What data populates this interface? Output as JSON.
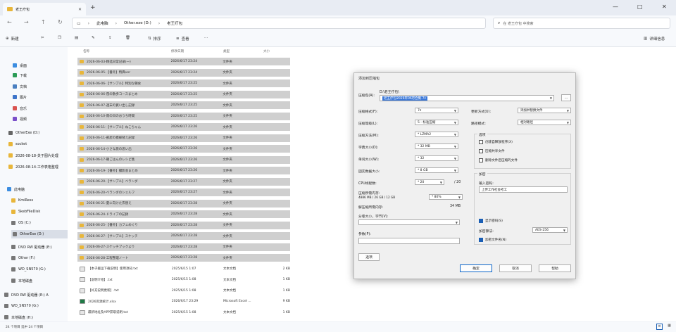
{
  "window": {
    "tab_title": "老王疗包",
    "controls": [
      "—",
      "□",
      "✕"
    ]
  },
  "address": {
    "crumbs": [
      "此电脑",
      "Other.exe (D:)",
      "老王疗包"
    ],
    "search_placeholder": "在 老王疗包 中搜索"
  },
  "toolbar": {
    "new_label": "新建",
    "sort_label": "排序",
    "view_label": "查看",
    "details_label": "详细信息"
  },
  "sidebar": {
    "items": [
      {
        "label": "桌面",
        "color": "#3c8de0"
      },
      {
        "label": "下载",
        "color": "#2a9b56"
      },
      {
        "label": "文档",
        "color": "#4a7fc0"
      },
      {
        "label": "图片",
        "color": "#3d74c9"
      },
      {
        "label": "音乐",
        "color": "#d9534f"
      },
      {
        "label": "视频",
        "color": "#7a4fc9"
      },
      {
        "label": "OtherExe (D:)",
        "color": "#666666"
      },
      {
        "label": "socket",
        "color": "#e8b63a"
      },
      {
        "label": "2026-08-18-关于图片处理",
        "color": "#e8b63a"
      },
      {
        "label": "2026-08-14-工作表格整理",
        "color": "#e8b63a"
      },
      {
        "label": "此电脑",
        "color": "#3c8de0"
      },
      {
        "label": "KmiRess",
        "color": "#e8b63a"
      },
      {
        "label": "SkebFileDisk",
        "color": "#e8b63a"
      },
      {
        "label": "OS (C:)",
        "color": "#777777"
      },
      {
        "label": "OtherExe (D:)",
        "color": "#777777"
      },
      {
        "label": "DVD RW 驱动器 (E:)",
        "color": "#777777"
      },
      {
        "label": "Other (F:)",
        "color": "#777777"
      },
      {
        "label": "WD_SN570 (G:)",
        "color": "#777777"
      },
      {
        "label": "本地磁盘",
        "color": "#777777"
      },
      {
        "label": "DVD RW 驱动器 (E:) A",
        "color": "#777777"
      },
      {
        "label": "WD_SN570 (G:)",
        "color": "#777777"
      },
      {
        "label": "本地磁盘 (H:)",
        "color": "#777777"
      }
    ]
  },
  "filelist": {
    "columns": [
      "名称",
      "修改日期",
      "类型",
      "大小"
    ],
    "rows": [
      {
        "name": "2026-06-03-精选日常记录(一)",
        "date": "2026/6/17 23:24",
        "type": "文件夹",
        "size": "",
        "folder": true
      },
      {
        "name": "2026-06-05-【番外】特典ver",
        "date": "2026/6/17 23:24",
        "type": "文件夹",
        "size": "",
        "folder": true
      },
      {
        "name": "2026-06-06-【サンプル】特別な朝食",
        "date": "2026/6/17 23:25",
        "type": "文件夹",
        "size": "",
        "folder": true
      },
      {
        "name": "2026-06-06-夜の散歩コースまとめ",
        "date": "2026/6/17 23:25",
        "type": "文件夹",
        "size": "",
        "folder": true
      },
      {
        "name": "2026-06-07-週末の買い出し記録",
        "date": "2026/6/17 23:25",
        "type": "文件夹",
        "size": "",
        "folder": true
      },
      {
        "name": "2026-06-10-雨の日のおうち時間",
        "date": "2026/6/17 23:25",
        "type": "文件夹",
        "size": "",
        "folder": true
      },
      {
        "name": "2026-06-11-【サンプル】ねこちゃん",
        "date": "2026/6/17 23:26",
        "type": "文件夹",
        "size": "",
        "folder": true
      },
      {
        "name": "2026-06-11-部屋の模様替え記録",
        "date": "2026/6/17 23:26",
        "type": "文件夹",
        "size": "",
        "folder": true
      },
      {
        "name": "2026-06-14-小さな旅の思い出",
        "date": "2026/6/17 23:26",
        "type": "文件夹",
        "size": "",
        "folder": true
      },
      {
        "name": "2026-06-17-朝ごはんのレシピ集",
        "date": "2026/6/17 23:26",
        "type": "文件夹",
        "size": "",
        "folder": true
      },
      {
        "name": "2026-06-19-【番外】撮影会まとめ",
        "date": "2026/6/17 23:26",
        "type": "文件夹",
        "size": "",
        "folder": true
      },
      {
        "name": "2026-06-20-【サンプル】ベランダ",
        "date": "2026/6/17 23:27",
        "type": "文件夹",
        "size": "",
        "folder": true
      },
      {
        "name": "2026-06-20-ベランダのシェルフ",
        "date": "2026/6/17 23:27",
        "type": "文件夹",
        "size": "",
        "folder": true
      },
      {
        "name": "2026-06-21-夏に向けた衣替え",
        "date": "2026/6/17 23:28",
        "type": "文件夹",
        "size": "",
        "folder": true
      },
      {
        "name": "2026-06-24-ドライブの記録",
        "date": "2026/6/17 23:28",
        "type": "文件夹",
        "size": "",
        "folder": true
      },
      {
        "name": "2026-06-25-【番外】カフェめぐり",
        "date": "2026/6/17 23:28",
        "type": "文件夹",
        "size": "",
        "folder": true
      },
      {
        "name": "2026-06-27-【サンプル】スケッチ",
        "date": "2026/6/17 23:28",
        "type": "文件夹",
        "size": "",
        "folder": true
      },
      {
        "name": "2026-06-27-スケッチブックより",
        "date": "2026/6/17 23:28",
        "type": "文件夹",
        "size": "",
        "folder": true
      },
      {
        "name": "2026-06-28-工程整理ノート",
        "date": "2026/6/17 23:28",
        "type": "文件夹",
        "size": "",
        "folder": true
      },
      {
        "name": "【本子搬运下载说明】使用须知.txt",
        "date": "2025/6/15 1:07",
        "type": "文本文档",
        "size": "2 KB",
        "folder": false
      },
      {
        "name": "【说明介绍】.txt",
        "date": "2025/6/15 1:08",
        "type": "文本文档",
        "size": "1 KB",
        "folder": false
      },
      {
        "name": "【补充说明更新】.txt",
        "date": "2025/6/15 1:08",
        "type": "文本文档",
        "size": "1 KB",
        "folder": false
      },
      {
        "name": "2026资源统计.xlsx",
        "date": "2026/6/17 23:29",
        "type": "Microsoft Excel ...",
        "size": "9 KB",
        "folder": false
      },
      {
        "name": "最新地址及APP获取说明.txt",
        "date": "2025/6/15 1:08",
        "type": "文本文档",
        "size": "1 KB",
        "folder": false
      }
    ]
  },
  "status": {
    "text": "24 个项目   选中 24 个项目"
  },
  "dialog": {
    "title": "添加到压缩包",
    "archive_label": "压缩包(A):",
    "archive_path_label": "D:\\老王疗包\\",
    "archive_value": "老王疗包2026年06月合集.7z",
    "browse_label": "...",
    "format_label": "压缩格式(F):",
    "format_value": "7z",
    "level_label": "压缩等级(L):",
    "level_value": "5 - 标准压缩",
    "method_label": "压缩方法(M):",
    "method_value": "* LZMA2",
    "dict_label": "字典大小(D):",
    "dict_value": "* 32 MB",
    "word_label": "单词大小(W):",
    "word_value": "* 32",
    "solid_label": "固实数据大小:",
    "solid_value": "* 8 GB",
    "cpu_label": "CPU线程数:",
    "cpu_value": "* 20",
    "cpu_max": "/ 20",
    "mem_label": "压缩所需内存:",
    "mem_sub": "4886 MB / 26 GB / 12 GB",
    "mem_value": "* 80%",
    "mem_pct": "",
    "decomp_label": "解压缩所需内存:",
    "decomp_value": "34 MB",
    "split_label": "分卷大小，字节(V):",
    "params_label": "参数(P):",
    "update_label": "更新方式(U):",
    "update_value": "添加并替换文件",
    "path_mode_label": "路径模式:",
    "path_mode_value": "相对路径",
    "options_title": "选项",
    "opt1": "创建自释放程序(X)",
    "opt2": "压缩共享文件",
    "opt3": "删除文件后压缩的文件",
    "encrypt_title": "加密",
    "password_label": "输入密码:",
    "password_value": "上传工作社会考工",
    "show_password": "显示密码(S)",
    "enc_method_label": "加密算法:",
    "enc_method_value": "AES-256",
    "enc_names": "加密文件名(N)",
    "options_btn": "选项",
    "ok": "确定",
    "cancel": "取消",
    "help": "帮助"
  }
}
